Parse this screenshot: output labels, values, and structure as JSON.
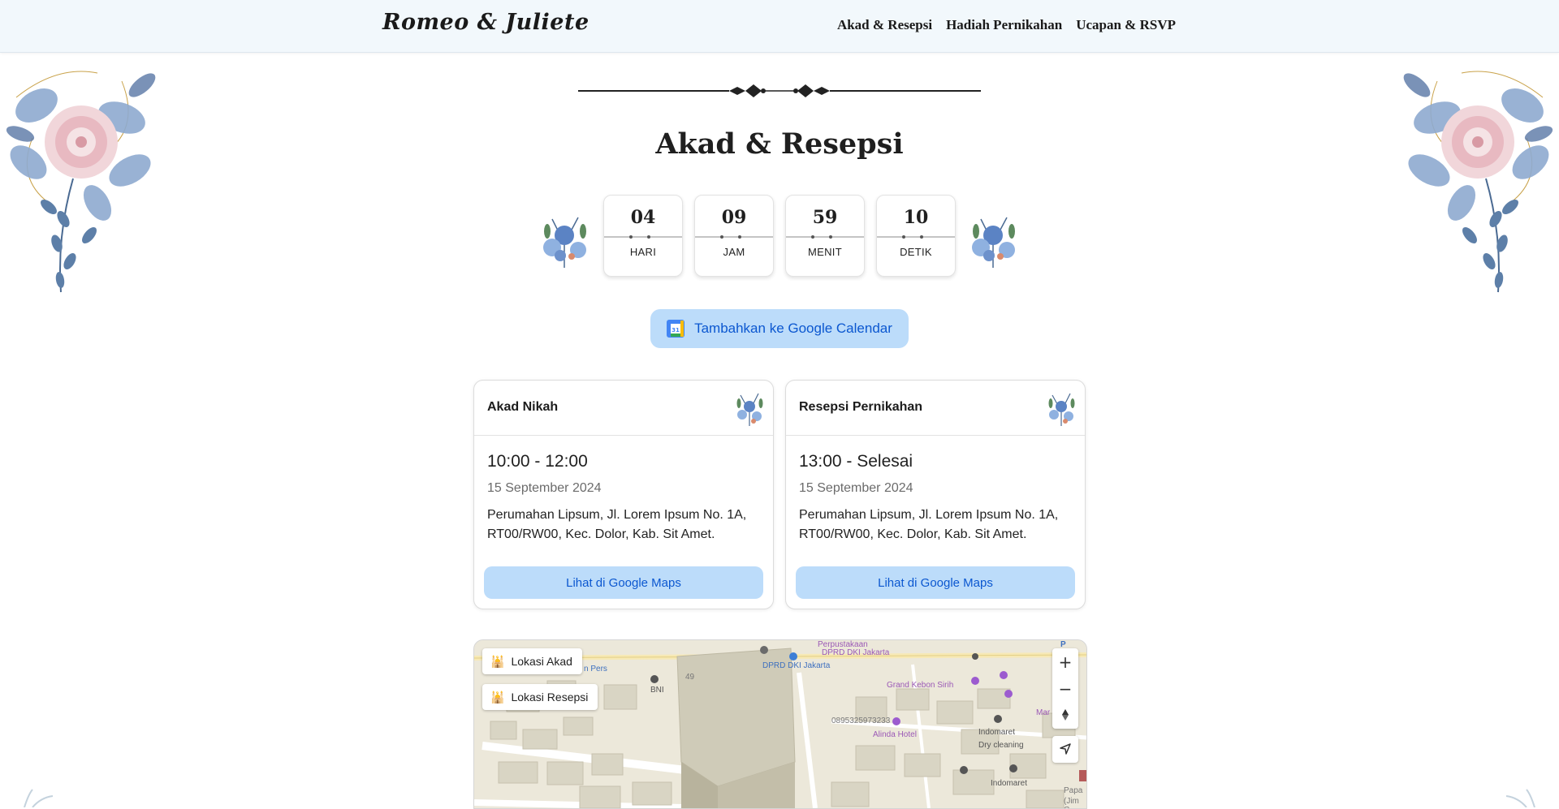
{
  "navbar": {
    "brand": "Romeo & Juliete",
    "links": [
      "Akad & Resepsi",
      "Hadiah Pernikahan",
      "Ucapan & RSVP"
    ]
  },
  "section": {
    "title": "Akad & Resepsi"
  },
  "countdown": [
    {
      "value": "04",
      "label": "HARI"
    },
    {
      "value": "09",
      "label": "JAM"
    },
    {
      "value": "59",
      "label": "MENIT"
    },
    {
      "value": "10",
      "label": "DETIK"
    }
  ],
  "calendar_button": {
    "label": "Tambahkan ke Google Calendar",
    "icon": "google-calendar-icon",
    "icon_text": "31"
  },
  "events": [
    {
      "title": "Akad Nikah",
      "time": "10:00 - 12:00",
      "date": "15 September 2024",
      "address": "Perumahan Lipsum, Jl. Lorem Ipsum No. 1A, RT00/RW00, Kec. Dolor, Kab. Sit Amet.",
      "button": "Lihat di Google Maps"
    },
    {
      "title": "Resepsi Pernikahan",
      "time": "13:00 - Selesai",
      "date": "15 September 2024",
      "address": "Perumahan Lipsum, Jl. Lorem Ipsum No. 1A, RT00/RW00, Kec. Dolor, Kab. Sit Amet.",
      "button": "Lihat di Google Maps"
    }
  ],
  "map": {
    "markers": [
      "Lokasi Akad",
      "Lokasi Resepsi"
    ],
    "controls": {
      "zoom_in": "+",
      "zoom_out": "−"
    },
    "labels": {
      "perpus1": "Perpustakaan",
      "perpus2": "DPRD DKI Jakarta",
      "dprd": "DPRD DKI Jakarta",
      "pers": "n Pers",
      "bni": "BNI",
      "num49": "49",
      "grand": "Grand Kebon Sirih",
      "phone": "0895325973233",
      "alinda": "Alinda Hotel",
      "indomaret1": "Indomaret",
      "dry": "Dry cleaning",
      "indomaret2": "Indomaret",
      "mar": "Mar",
      "papa": "Papa",
      "jim": "(Jim C",
      "p": "P"
    }
  },
  "colors": {
    "accent_button": "#bcdcfa",
    "accent_text": "#0b57d0",
    "navbar_bg": "#f2f8fc"
  }
}
